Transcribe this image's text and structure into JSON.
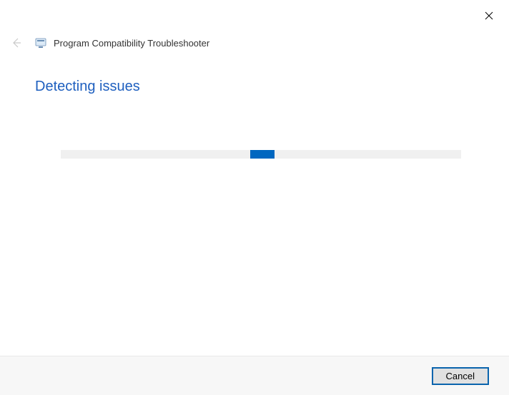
{
  "window": {
    "close_label": "Close"
  },
  "header": {
    "title": "Program Compatibility Troubleshooter"
  },
  "main": {
    "heading": "Detecting issues"
  },
  "footer": {
    "cancel_label": "Cancel"
  }
}
